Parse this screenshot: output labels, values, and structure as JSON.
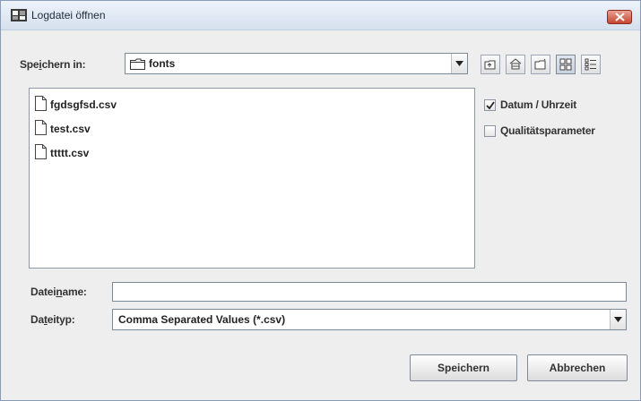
{
  "window": {
    "title": "Logdatei öffnen"
  },
  "save_in": {
    "label_before": "Spe",
    "label_mnemonic": "i",
    "label_after": "chern in:",
    "value": "fonts"
  },
  "toolbar": [
    {
      "name": "up-one-level",
      "icon": "folder-up-icon"
    },
    {
      "name": "home",
      "icon": "home-icon"
    },
    {
      "name": "new-folder",
      "icon": "new-folder-icon"
    },
    {
      "name": "list-view",
      "icon": "list-view-icon"
    },
    {
      "name": "details-view",
      "icon": "details-view-icon"
    }
  ],
  "files": [
    "fgdsgfsd.csv",
    "test.csv",
    "ttttt.csv"
  ],
  "options": {
    "datum": {
      "label": "Datum / Uhrzeit",
      "checked": true
    },
    "qualitaet": {
      "label": "Qualitätsparameter",
      "checked": false
    }
  },
  "filename": {
    "label_before": "Datei",
    "label_mnemonic": "n",
    "label_after": "ame:",
    "value": ""
  },
  "filetype": {
    "label_before": "Da",
    "label_mnemonic": "t",
    "label_after": "eityp:",
    "value": "Comma Separated Values (*.csv)"
  },
  "buttons": {
    "save": "Speichern",
    "cancel": "Abbrechen"
  }
}
